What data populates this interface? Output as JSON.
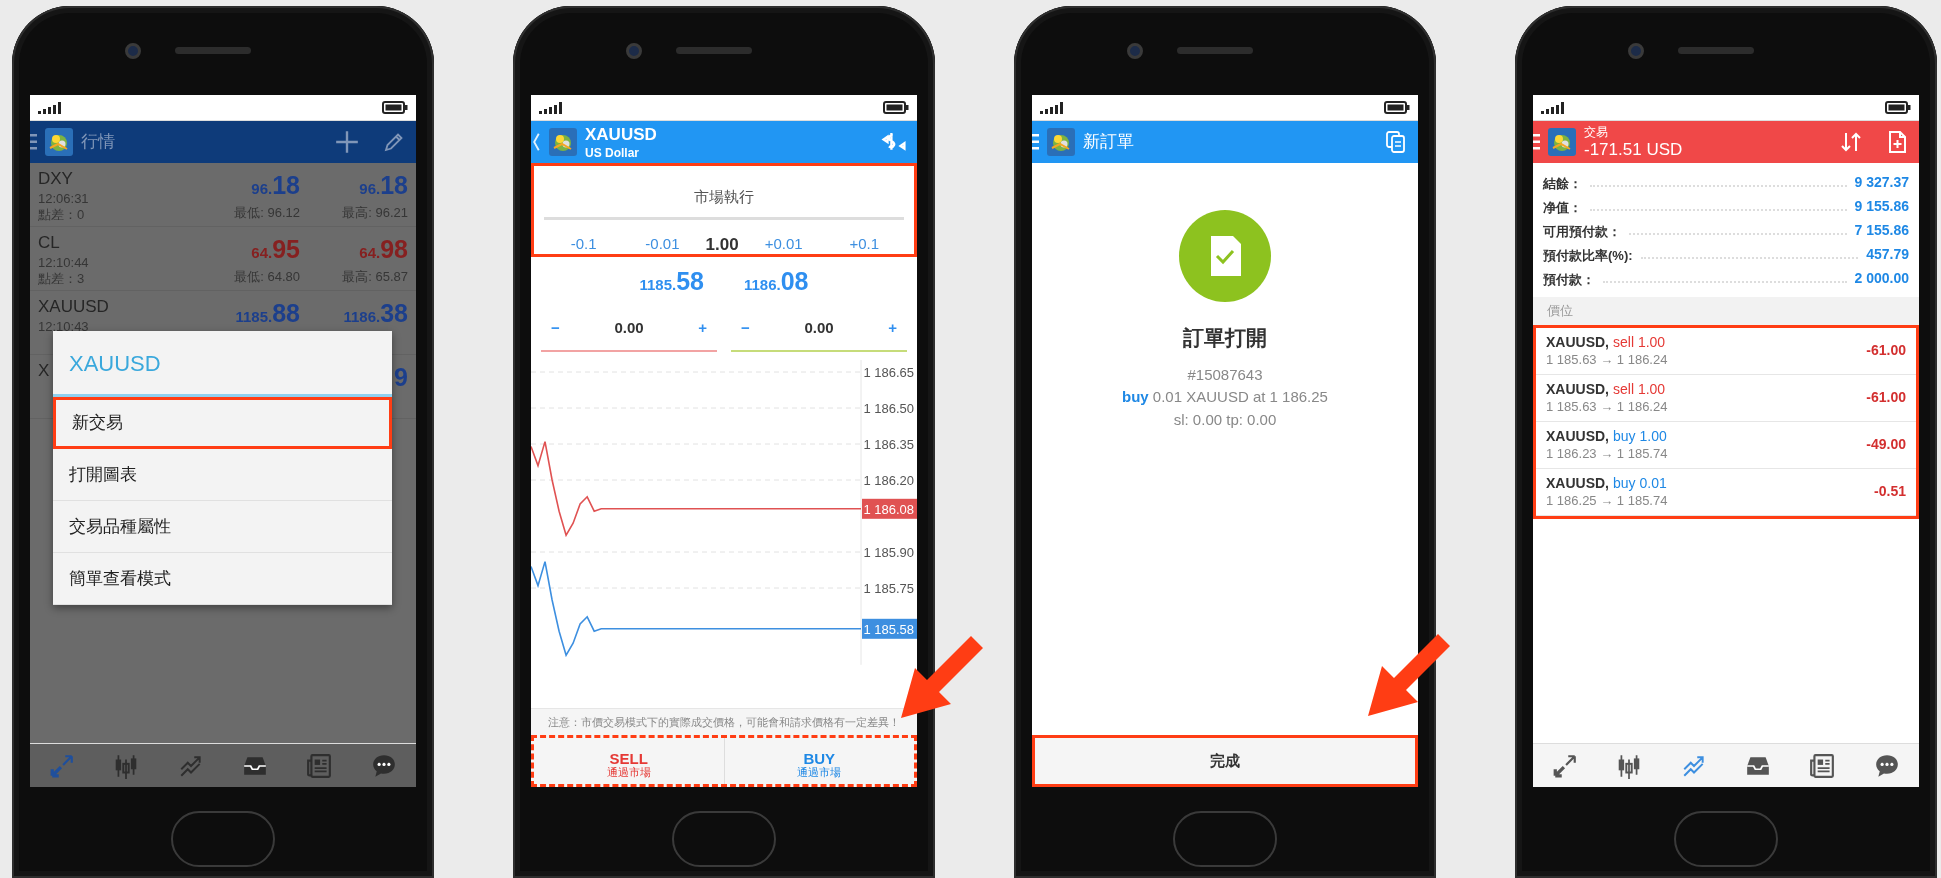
{
  "phones": [
    {
      "kind": "quotes",
      "dimmed": true,
      "header": {
        "title": "行情"
      },
      "quotes": [
        {
          "symbol": "DXY",
          "time": "12:06:31",
          "spread": "點差：0",
          "bid": "96.18",
          "ask": "96.18",
          "low": "最低: 96.12",
          "high": "最高: 96.21",
          "kind": "up"
        },
        {
          "symbol": "CL",
          "time": "12:10:44",
          "spread": "點差：3",
          "bid": "64.95",
          "ask": "64.98",
          "low": "最低: 64.80",
          "high": "最高: 65.87",
          "kind": "down"
        },
        {
          "symbol": "XAUUSD",
          "time": "12:10:43",
          "bid": "1185.88",
          "ask": "1186.38",
          "kind": "up"
        },
        {
          "symbol": "X",
          "ask": "9",
          "kind": "up"
        }
      ],
      "menu": {
        "title": "XAUUSD",
        "items": [
          {
            "label": "新交易",
            "highlighted": true
          },
          {
            "label": "打開圖表",
            "highlighted": false
          },
          {
            "label": "交易品種屬性",
            "highlighted": false
          },
          {
            "label": "簡單查看模式",
            "highlighted": false
          }
        ]
      },
      "nav": [
        {
          "kind": "quotes",
          "selected": true
        },
        {
          "kind": "chart",
          "selected": false
        },
        {
          "kind": "trade",
          "selected": false
        },
        {
          "kind": "mail",
          "selected": false
        },
        {
          "kind": "news",
          "selected": false
        },
        {
          "kind": "chat",
          "selected": false
        }
      ]
    },
    {
      "kind": "order",
      "header": {
        "title": "XAUUSD",
        "subtitle": "US Dollar"
      },
      "form_frame": {
        "kind": "solid"
      },
      "order_type": "市場執行",
      "volume_row": [
        {
          "kind": "step",
          "label": "-0.1"
        },
        {
          "kind": "step",
          "label": "-0.01"
        },
        {
          "kind": "value",
          "label": "1.00"
        },
        {
          "kind": "step",
          "label": "+0.01"
        },
        {
          "kind": "step",
          "label": "+0.1"
        }
      ],
      "prices": {
        "bid": "1185.58",
        "ask": "1186.08"
      },
      "stops": [
        {
          "kind": "stop_loss",
          "minus": "−",
          "value": "0.00",
          "plus": "+"
        },
        {
          "kind": "take_profit",
          "minus": "−",
          "value": "0.00",
          "plus": "+"
        }
      ],
      "chart_data": {
        "type": "line",
        "grid": true,
        "series": [
          {
            "color": "#e05252",
            "values": [
              1186.34,
              1186.26,
              1186.36,
              1186.2,
              1186.07,
              1185.97,
              1186.02,
              1186.1,
              1186.13,
              1186.07,
              1186.08,
              1186.08,
              1186.08,
              1186.08,
              1186.08,
              1186.08,
              1186.08,
              1186.08,
              1186.08,
              1186.08,
              1186.08,
              1186.08,
              1186.08,
              1186.08,
              1186.08,
              1186.08,
              1186.08,
              1186.08,
              1186.08,
              1186.08,
              1186.08,
              1186.08,
              1186.08,
              1186.08,
              1186.08,
              1186.08,
              1186.08,
              1186.08,
              1186.08,
              1186.08,
              1186.08,
              1186.08,
              1186.08,
              1186.08,
              1186.08,
              1186.08,
              1186.08,
              1186.08
            ]
          },
          {
            "color": "#3d8fe0",
            "values": [
              1185.84,
              1185.76,
              1185.86,
              1185.7,
              1185.57,
              1185.47,
              1185.52,
              1185.6,
              1185.63,
              1185.57,
              1185.58,
              1185.58,
              1185.58,
              1185.58,
              1185.58,
              1185.58,
              1185.58,
              1185.58,
              1185.58,
              1185.58,
              1185.58,
              1185.58,
              1185.58,
              1185.58,
              1185.58,
              1185.58,
              1185.58,
              1185.58,
              1185.58,
              1185.58,
              1185.58,
              1185.58,
              1185.58,
              1185.58,
              1185.58,
              1185.58,
              1185.58,
              1185.58,
              1185.58,
              1185.58,
              1185.58,
              1185.58,
              1185.58,
              1185.58,
              1185.58,
              1185.58,
              1185.58,
              1185.58
            ]
          }
        ],
        "ylim": [
          1185.43,
          1186.7
        ],
        "yticks": [
          {
            "value": 1186.65,
            "label": "1 186.65"
          },
          {
            "value": 1186.5,
            "label": "1 186.50"
          },
          {
            "value": 1186.35,
            "label": "1 186.35"
          },
          {
            "value": 1186.2,
            "label": "1 186.20"
          },
          {
            "value": 1185.9,
            "label": "1 185.90"
          },
          {
            "value": 1185.75,
            "label": "1 185.75"
          }
        ]
      },
      "price_tags": [
        {
          "kind": "ask",
          "label": "1 186.08"
        },
        {
          "kind": "bid",
          "label": "1 185.58"
        }
      ],
      "notice": "注意：市價交易模式下的實際成交價格，可能會和請求價格有一定差異！",
      "actions_frame": {
        "kind": "dashed"
      },
      "actions": [
        {
          "kind": "sell",
          "label": "SELL",
          "sublabel": "通過市場"
        },
        {
          "kind": "buy",
          "label": "BUY",
          "sublabel": "通過市場"
        }
      ],
      "pointer_arrow": true
    },
    {
      "kind": "confirmation",
      "header": {
        "title": "新訂單"
      },
      "result": {
        "title": "訂單打開",
        "ticket": "#15087643",
        "side": "buy",
        "detail": "0.01 XAUUSD at 1 186.25",
        "stops": "sl: 0.00 tp: 0.00"
      },
      "done_button": {
        "label": "完成",
        "highlighted": true
      },
      "pointer_arrow": true
    },
    {
      "kind": "trade",
      "header": {
        "title": "交易",
        "subtitle": "-171.51 USD"
      },
      "account": [
        {
          "label": "結餘：",
          "value": "9 327.37"
        },
        {
          "label": "净值：",
          "value": "9 155.86"
        },
        {
          "label": "可用預付款：",
          "value": "7 155.86"
        },
        {
          "label": "預付款比率(%):",
          "value": "457.79"
        },
        {
          "label": "預付款：",
          "value": "2 000.00"
        }
      ],
      "section": "價位",
      "positions_frame": {
        "kind": "solid"
      },
      "positions": [
        {
          "symbol": "XAUUSD,",
          "kind": "sell",
          "order": "sell 1.00",
          "prices": "1 185.63 → 1 186.24",
          "profit": "-61.00"
        },
        {
          "symbol": "XAUUSD,",
          "kind": "sell",
          "order": "sell 1.00",
          "prices": "1 185.63 → 1 186.24",
          "profit": "-61.00"
        },
        {
          "symbol": "XAUUSD,",
          "kind": "buy",
          "order": "buy 1.00",
          "prices": "1 186.23 → 1 185.74",
          "profit": "-49.00"
        },
        {
          "symbol": "XAUUSD,",
          "kind": "buy",
          "order": "buy 0.01",
          "prices": "1 186.25 → 1 185.74",
          "profit": "-0.51"
        }
      ],
      "nav": [
        {
          "kind": "quotes",
          "selected": false
        },
        {
          "kind": "chart",
          "selected": false
        },
        {
          "kind": "trade",
          "selected": true
        },
        {
          "kind": "mail",
          "selected": false
        },
        {
          "kind": "news",
          "selected": false
        },
        {
          "kind": "chat",
          "selected": false
        }
      ]
    }
  ]
}
